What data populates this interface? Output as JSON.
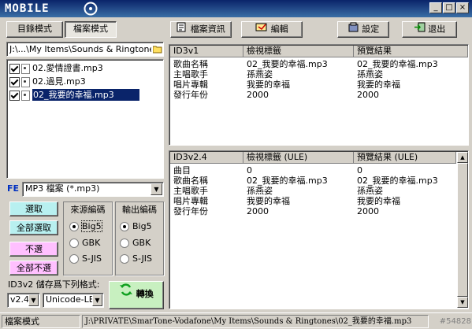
{
  "window": {
    "logo_text": "MOBILE",
    "controls": [
      "_",
      "□",
      "×"
    ]
  },
  "mode_tabs": {
    "directory": "目錄模式",
    "file": "檔案模式"
  },
  "toolbar": {
    "file_info": "檔案資訊",
    "edit": "編輯",
    "settings": "設定",
    "exit": "退出"
  },
  "path_box": "J:\\...\\My Items\\Sounds & Ringtones",
  "files": [
    {
      "name": "02.愛情證書.mp3",
      "checked": true,
      "selected": false
    },
    {
      "name": "02.過見.mp3",
      "checked": true,
      "selected": false
    },
    {
      "name": "02_我要的幸福.mp3",
      "checked": true,
      "selected": true
    }
  ],
  "filter": {
    "badge": "FE",
    "value": "MP3 檔案 (*.mp3)"
  },
  "select_buttons": {
    "select": "選取",
    "select_all": "全部選取",
    "deselect": "不選",
    "deselect_all": "全部不選"
  },
  "source_encoding": {
    "label": "來源編碼",
    "options": [
      "Big5",
      "GBK",
      "S-JIS"
    ],
    "selected": "Big5"
  },
  "output_encoding": {
    "label": "輸出編碼",
    "options": [
      "Big5",
      "GBK",
      "S-JIS"
    ],
    "selected": "Big5"
  },
  "id3v2_save": {
    "label": "ID3v2 儲存爲下列格式:",
    "version": "v2.4",
    "format": "Unicode-LE"
  },
  "convert_button": "轉換",
  "id3v1_table": {
    "headers": [
      "ID3v1",
      "檢視標籤",
      "預覽結果"
    ],
    "rows": [
      [
        "歌曲名稱",
        "02_我要的幸福.mp3",
        "02_我要的幸福.mp3"
      ],
      [
        "主唱歌手",
        "孫燕姿",
        "孫燕姿"
      ],
      [
        "唱片專輯",
        "我要的幸福",
        "我要的幸福"
      ],
      [
        "發行年份",
        "2000",
        "2000"
      ]
    ]
  },
  "id3v2_table": {
    "headers": [
      "ID3v2.4",
      "檢視標籤 (ULE)",
      "預覽結果 (ULE)"
    ],
    "rows": [
      [
        "曲目",
        "0",
        "0"
      ],
      [
        "歌曲名稱",
        "02_我要的幸福.mp3",
        "02_我要的幸福.mp3"
      ],
      [
        "主唱歌手",
        "孫燕姿",
        "孫燕姿"
      ],
      [
        "唱片專輯",
        "我要的幸福",
        "我要的幸福"
      ],
      [
        "發行年份",
        "2000",
        "2000"
      ]
    ]
  },
  "status": {
    "mode": "檔案模式",
    "path": "J:\\PRIVATE\\SmarTone-Vodafone\\My Items\\Sounds & Ringtones\\02_我要的幸福.mp3",
    "watermark": "#54828"
  },
  "colors": {
    "selection": "#0a246a",
    "select_buttons": "#b8f0f0",
    "deselect_buttons": "#ffc0ff",
    "convert_button": "#c8f0c0"
  }
}
